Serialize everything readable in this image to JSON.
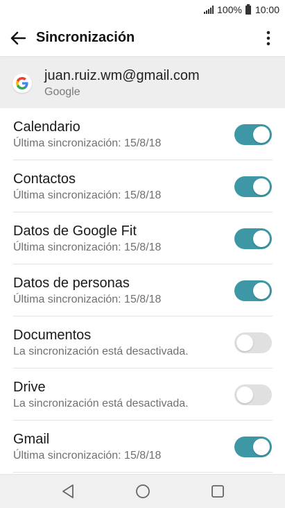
{
  "status_bar": {
    "battery": "100%",
    "time": "10:00"
  },
  "app_bar": {
    "title": "Sincronización"
  },
  "account": {
    "email": "juan.ruiz.wm@gmail.com",
    "type": "Google"
  },
  "sync_items": [
    {
      "name": "Calendario",
      "status": "Última sincronización: 15/8/18",
      "enabled": true
    },
    {
      "name": "Contactos",
      "status": "Última sincronización: 15/8/18",
      "enabled": true
    },
    {
      "name": "Datos de Google Fit",
      "status": "Última sincronización: 15/8/18",
      "enabled": true
    },
    {
      "name": "Datos de personas",
      "status": "Última sincronización: 15/8/18",
      "enabled": true
    },
    {
      "name": "Documentos",
      "status": "La sincronización está desactivada.",
      "enabled": false
    },
    {
      "name": "Drive",
      "status": "La sincronización está desactivada.",
      "enabled": false
    },
    {
      "name": "Gmail",
      "status": "Última sincronización: 15/8/18",
      "enabled": true
    }
  ],
  "colors": {
    "toggle_on": "#3d97a5",
    "toggle_off": "#e0e0e0"
  },
  "icons": {
    "back": "arrow-back-icon",
    "more": "more-vert-icon",
    "account": "google-logo-icon",
    "nav": [
      "back-triangle-icon",
      "home-circle-icon",
      "recents-square-icon"
    ]
  }
}
